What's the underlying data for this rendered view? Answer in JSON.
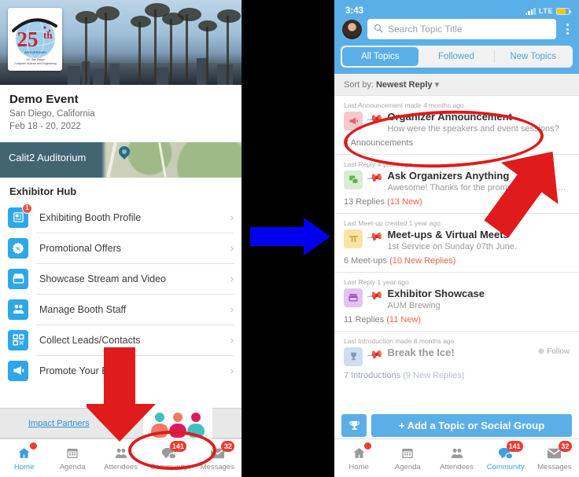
{
  "left_app": {
    "event": {
      "title": "Demo Event",
      "location": "San Diego, California",
      "dates": "Feb 18 - 20, 2022",
      "logo_alt": "25th Anniversary UC San Diego Computer Science and Engineering"
    },
    "venue": {
      "name": "Calit2 Auditorium"
    },
    "hub": {
      "title": "Exhibitor Hub",
      "items": [
        {
          "label": "Exhibiting Booth Profile",
          "icon": "booth-profile-icon",
          "badge": "1",
          "chevron": "›"
        },
        {
          "label": "Promotional Offers",
          "icon": "percent-badge-icon",
          "badge": "",
          "chevron": "›"
        },
        {
          "label": "Showcase Stream and Video",
          "icon": "storefront-icon",
          "badge": "",
          "chevron": "›"
        },
        {
          "label": "Manage Booth Staff",
          "icon": "people-group-icon",
          "badge": "",
          "chevron": "›"
        },
        {
          "label": "Collect Leads/Contacts",
          "icon": "qr-code-icon",
          "badge": "",
          "chevron": "›"
        },
        {
          "label": "Promote Your Booth",
          "icon": "megaphone-icon",
          "badge": "",
          "chevron": "›"
        }
      ]
    },
    "partners": {
      "link_label": "Impact Partners"
    },
    "tabbar": [
      {
        "label": "Home",
        "icon": "home-icon",
        "badge": "",
        "dot": true,
        "active": true
      },
      {
        "label": "Agenda",
        "icon": "calendar-icon",
        "badge": "",
        "dot": false,
        "active": false
      },
      {
        "label": "Attendees",
        "icon": "attendees-icon",
        "badge": "",
        "dot": false,
        "active": false
      },
      {
        "label": "Community",
        "icon": "chat-bubbles-icon",
        "badge": "141",
        "dot": false,
        "active": false
      },
      {
        "label": "Messages",
        "icon": "envelope-icon",
        "badge": "32",
        "dot": false,
        "active": false
      }
    ]
  },
  "right_app": {
    "statusbar": {
      "time": "3:43",
      "network": "LTE",
      "signal_icon": "signal-bars-icon",
      "battery_icon": "battery-icon"
    },
    "search": {
      "placeholder": "Search Topic Title",
      "value": "",
      "icon": "search-icon",
      "menu_icon": "overflow-menu-icon",
      "avatar": "user-avatar"
    },
    "segments": [
      {
        "label": "All Topics",
        "active": true
      },
      {
        "label": "Followed",
        "active": false
      },
      {
        "label": "New Topics",
        "active": false
      }
    ],
    "sort": {
      "prefix": "Sort by:",
      "value": "Newest Reply",
      "caret": "▾"
    },
    "topics": [
      {
        "meta": "Last Announcement made 4 months ago",
        "title": "Organizer Announcement",
        "subtitle": "How were the speakers and event sessions?",
        "count": "8 Announcements",
        "new": "",
        "icon": "megaphone-icon",
        "icon_bg": "#f7c9c9",
        "icon_fg": "#e06565",
        "pin_icon": "pushpin-icon"
      },
      {
        "meta": "Last Reply 4 years ago",
        "title": "Ask Organizers Anything",
        "subtitle": "Awesome! Thanks for the prompt help - Lori Allen",
        "count": "13 Replies",
        "new": "(13 New)",
        "icon": "question-chat-icon",
        "icon_bg": "#d7eed0",
        "icon_fg": "#64b150",
        "pin_icon": "pushpin-icon"
      },
      {
        "meta": "Last Meet-up created 1 year ago",
        "title": "Meet-ups & Virtual Meets",
        "subtitle": "1st Service on Sunday 07th June.",
        "count": "6 Meet-ups",
        "new": "(10 New Replies)",
        "icon": "meetup-table-icon",
        "icon_bg": "#fbe3a8",
        "icon_fg": "#d89b20",
        "pin_icon": "pushpin-icon"
      },
      {
        "meta": "Last Reply 1 year ago",
        "title": "Exhibitor Showcase",
        "subtitle": "AUM Brewing",
        "count": "11 Replies",
        "new": "(11 New)",
        "icon": "storefront-icon",
        "icon_bg": "#e3c4f0",
        "icon_fg": "#9b4fc4",
        "pin_icon": "pushpin-icon"
      },
      {
        "meta": "Last Introduction made 8 months ago",
        "title": "Break the Ice!",
        "subtitle": "",
        "count": "7 Introductions",
        "new": "(9 New Replies)",
        "icon": "trophy-icon",
        "icon_bg": "#cddff0",
        "icon_fg": "#7d9bbd",
        "pin_icon": "pushpin-icon",
        "follow_label": "Follow"
      }
    ],
    "cta": {
      "label": "+ Add a Topic or Social Group",
      "icon": "trophy-icon"
    },
    "tabbar": [
      {
        "label": "Home",
        "icon": "home-icon",
        "badge": "",
        "dot": true,
        "active": false
      },
      {
        "label": "Agenda",
        "icon": "calendar-icon",
        "badge": "",
        "dot": false,
        "active": false
      },
      {
        "label": "Attendees",
        "icon": "attendees-icon",
        "badge": "",
        "dot": false,
        "active": false
      },
      {
        "label": "Community",
        "icon": "chat-bubbles-icon",
        "badge": "141",
        "dot": false,
        "active": true
      },
      {
        "label": "Messages",
        "icon": "envelope-icon",
        "badge": "32",
        "dot": false,
        "active": false
      }
    ]
  },
  "annotations": {
    "arrow_color_primary": "#e01b1b",
    "arrow_color_secondary": "#0000ee",
    "circle_color": "#e01b1b"
  }
}
